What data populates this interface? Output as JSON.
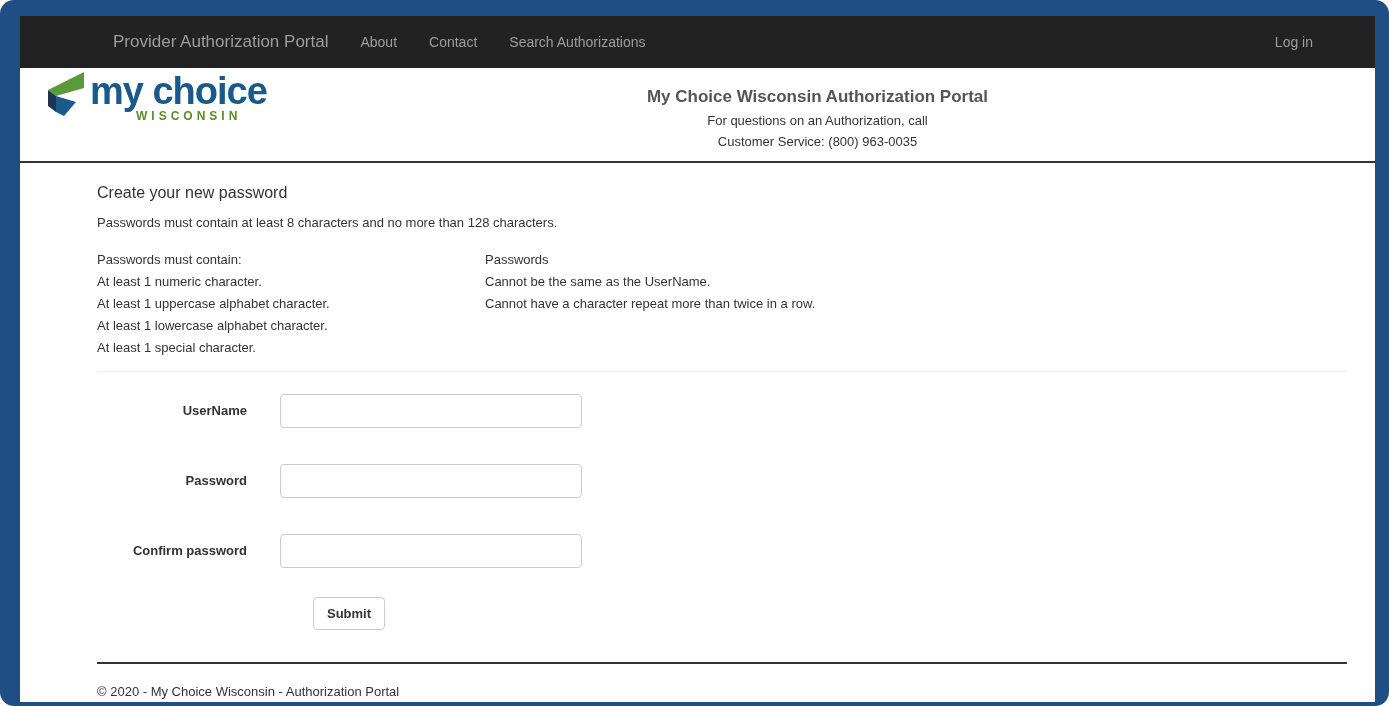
{
  "navbar": {
    "brand": "Provider Authorization Portal",
    "links": [
      "About",
      "Contact",
      "Search Authorizations"
    ],
    "right_link": "Log in"
  },
  "logo": {
    "line1": "my choice",
    "line2": "WISCONSIN"
  },
  "header": {
    "title": "My Choice Wisconsin Authorization Portal",
    "lines": [
      "For questions on an Authorization, call",
      "Customer Service: (800) 963-0035"
    ]
  },
  "heading": "Create your new password",
  "intro": "Passwords must contain at least 8 characters and no more than 128 characters.",
  "rule_columns": [
    {
      "title": "Passwords must contain:",
      "items": [
        "At least 1 numeric character.",
        "At least 1 uppercase alphabet character.",
        "At least 1 lowercase alphabet character.",
        "At least 1 special character."
      ]
    },
    {
      "title": "Passwords",
      "items": [
        "Cannot be the same as the UserName.",
        "Cannot have a character repeat more than twice in a row."
      ]
    }
  ],
  "fields": [
    {
      "label": "UserName"
    },
    {
      "label": "Password"
    },
    {
      "label": "Confirm password"
    }
  ],
  "submit": "Submit",
  "footer": "© 2020 - My Choice Wisconsin - Authorization Portal"
}
